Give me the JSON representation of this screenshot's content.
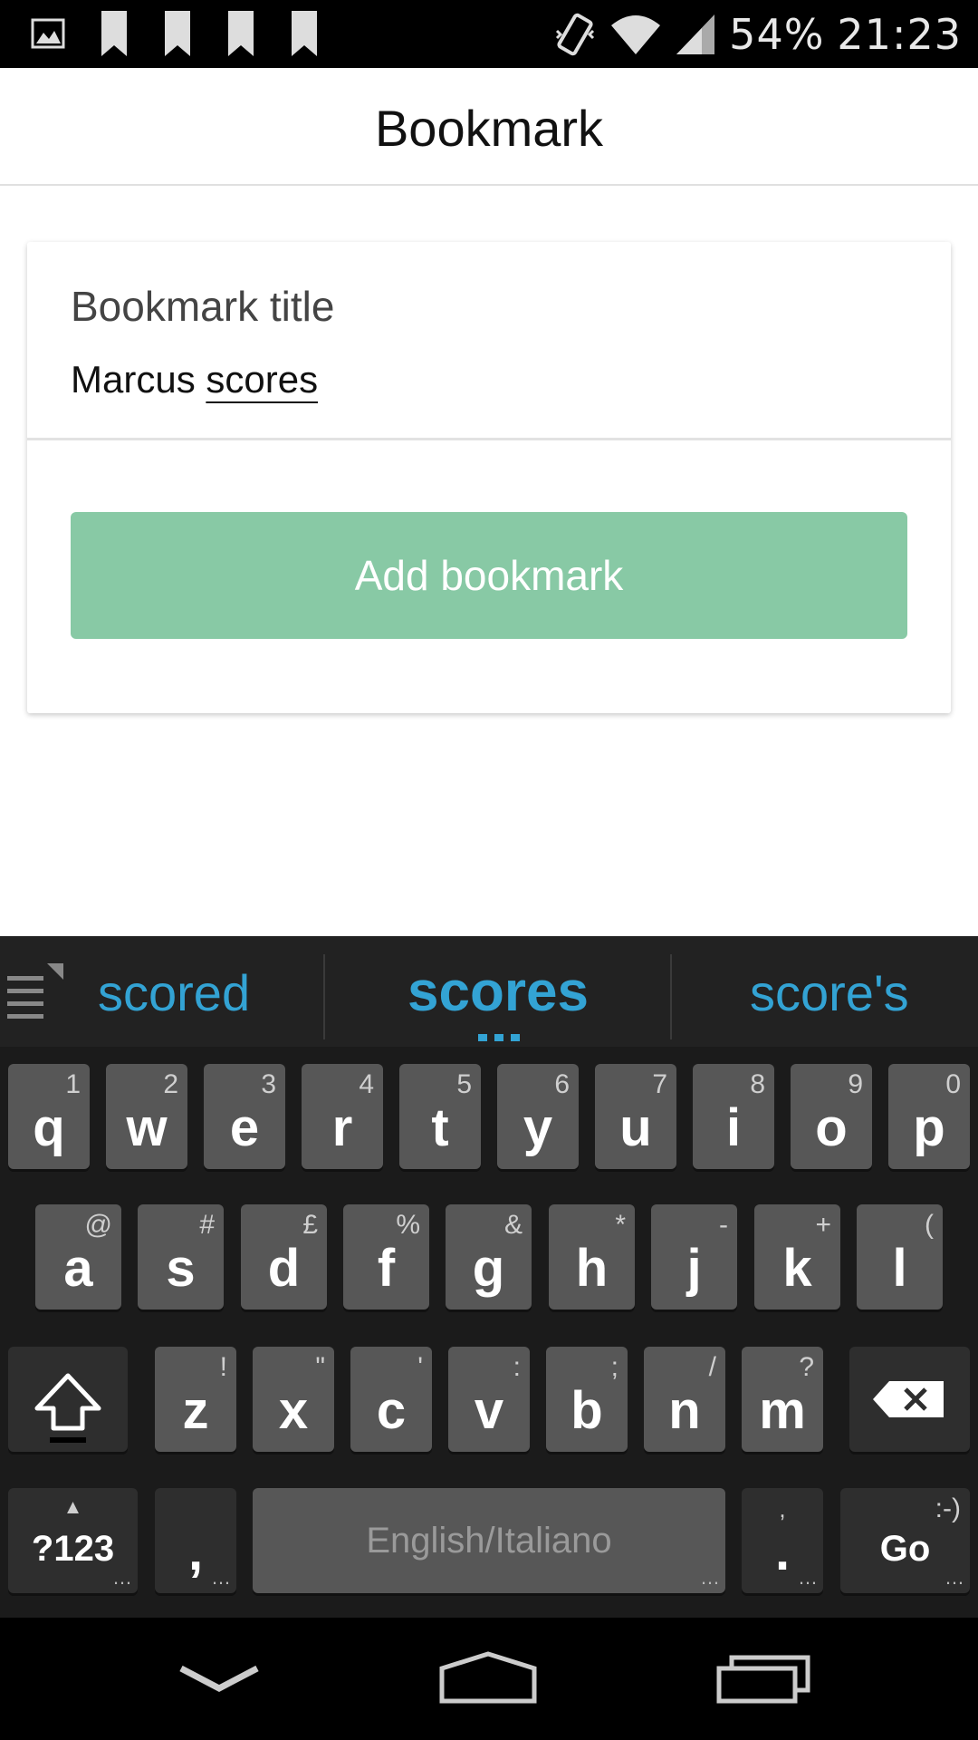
{
  "status_bar": {
    "battery": "54%",
    "time": "21:23",
    "left_icons": [
      "image-icon",
      "bookmark-icon",
      "bookmark-icon",
      "bookmark-icon",
      "bookmark-icon"
    ],
    "right_icons": [
      "vibrate-icon",
      "wifi-icon",
      "signal-icon"
    ]
  },
  "app_bar": {
    "title": "Bookmark"
  },
  "card": {
    "field_label": "Bookmark title",
    "value_prefix": "Marcus ",
    "value_composing": "scores",
    "button_label": "Add bookmark"
  },
  "colors": {
    "button": "#88c9a5",
    "suggestion": "#33a3d4",
    "keyboard_bg": "#1b1b1b"
  },
  "keyboard": {
    "suggestions": [
      "scored",
      "scores",
      "score's"
    ],
    "row1": [
      {
        "k": "q",
        "h": "1"
      },
      {
        "k": "w",
        "h": "2"
      },
      {
        "k": "e",
        "h": "3"
      },
      {
        "k": "r",
        "h": "4"
      },
      {
        "k": "t",
        "h": "5"
      },
      {
        "k": "y",
        "h": "6"
      },
      {
        "k": "u",
        "h": "7"
      },
      {
        "k": "i",
        "h": "8"
      },
      {
        "k": "o",
        "h": "9"
      },
      {
        "k": "p",
        "h": "0"
      }
    ],
    "row2": [
      {
        "k": "a",
        "h": "@"
      },
      {
        "k": "s",
        "h": "#"
      },
      {
        "k": "d",
        "h": "£"
      },
      {
        "k": "f",
        "h": "%"
      },
      {
        "k": "g",
        "h": "&"
      },
      {
        "k": "h",
        "h": "*"
      },
      {
        "k": "j",
        "h": "-"
      },
      {
        "k": "k",
        "h": "+"
      },
      {
        "k": "l",
        "h": "("
      }
    ],
    "row3": [
      {
        "k": "z",
        "h": "!"
      },
      {
        "k": "x",
        "h": "\""
      },
      {
        "k": "c",
        "h": "'"
      },
      {
        "k": "v",
        "h": ":"
      },
      {
        "k": "b",
        "h": ";"
      },
      {
        "k": "n",
        "h": "/"
      },
      {
        "k": "m",
        "h": "?"
      }
    ],
    "symbols_label": "?123",
    "symbols_hint": "▲",
    "comma_label": ",",
    "space_label": "English/Italiano",
    "period_label": ".",
    "period_hint": ",",
    "go_label": "Go",
    "go_hint": ":-)",
    "more_mark": "…"
  },
  "nav_bar": {
    "icons": [
      "back-icon",
      "home-icon",
      "recents-icon"
    ]
  }
}
